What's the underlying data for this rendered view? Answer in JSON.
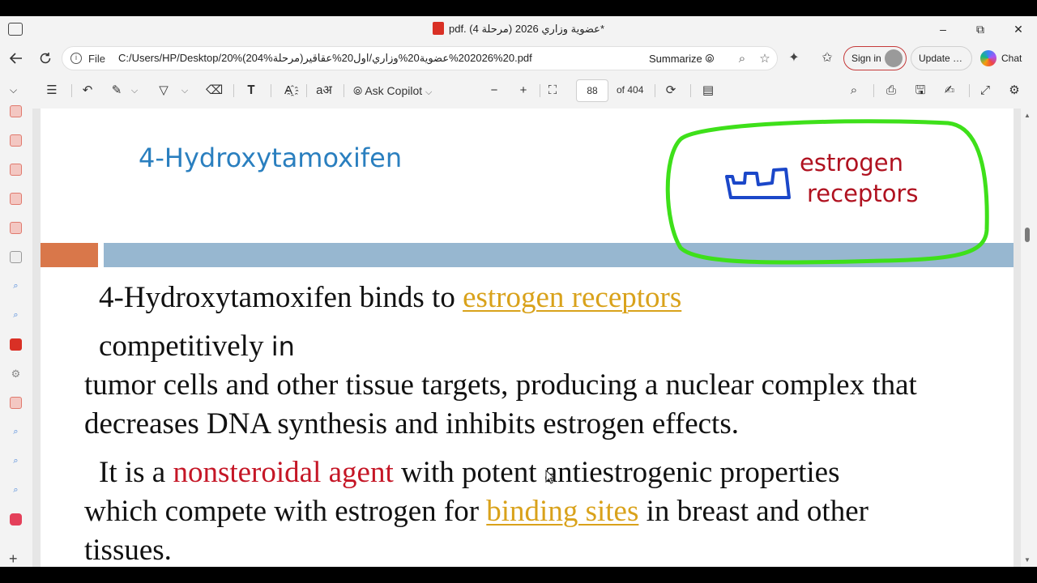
{
  "window": {
    "title": "pdf. (4 عضوية وزاري 2026 (مرحلة*",
    "minimize": "–",
    "restore": "⧉",
    "close": "✕"
  },
  "address": {
    "file_label": "File",
    "url": "C:/Users/HP/Desktop/20%(204%مرحلة)20%202026%عضوية20%وزاري/اول20%عقاقير.pdf",
    "summarize": "Summarize",
    "sign_in": "Sign in",
    "update": "Update",
    "update_more": "…",
    "chat": "Chat"
  },
  "pdf_toolbar": {
    "ask_copilot": "Ask Copilot",
    "page_number": "88",
    "page_total": "of 404"
  },
  "slide": {
    "title": "4-Hydroxytamoxifen",
    "annotation_line1": "estrogen",
    "annotation_line2": "receptors",
    "l1_pre": "4-Hydroxytamoxifen binds to ",
    "l1_link": "estrogen receptors",
    "l2": "competitively",
    "l2_hand": "in",
    "l3": "tumor cells and other tissue targets, producing a nuclear complex that",
    "l4": "decreases DNA synthesis and inhibits estrogen effects.",
    "l5_pre": "It is a ",
    "l5_red": "nonsteroidal agent",
    "l5_post": " with potent antiestrogenic properties",
    "l6_pre": "which compete with estrogen for ",
    "l6_link": "binding sites",
    "l6_post": " in breast and other",
    "l7": "tissues."
  },
  "colors": {
    "title_blue": "#2a7fbf",
    "annotation_red": "#b01220",
    "annotation_green": "#3ee01a",
    "highlight_yellow": "#d9a21b",
    "band_orange": "#d9774a",
    "band_blue": "#97b7d0"
  }
}
